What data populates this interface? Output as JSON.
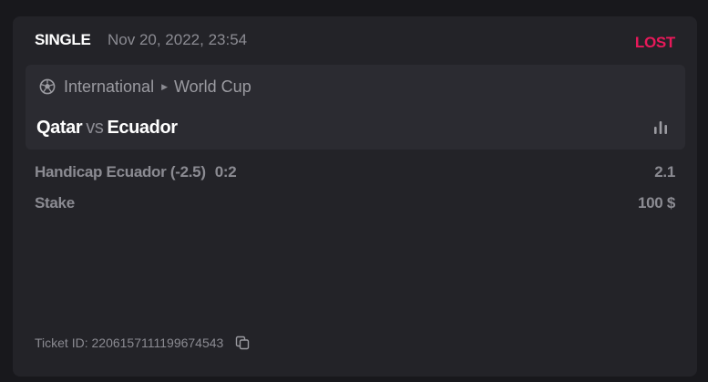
{
  "bet": {
    "type": "SINGLE",
    "date": "Nov 20, 2022, 23:54",
    "status": "LOST"
  },
  "event": {
    "sport_icon": "soccer-ball-icon",
    "category": "International",
    "separator_icon": "chevron-right-icon",
    "league": "World Cup",
    "home_team": "Qatar",
    "vs_label": "vs",
    "away_team": "Ecuador",
    "stats_icon": "bar-chart-icon"
  },
  "selection": {
    "market": "Handicap Ecuador (-2.5)",
    "score": "0:2",
    "odds": "2.1"
  },
  "stake": {
    "label": "Stake",
    "value": "100 $"
  },
  "ticket": {
    "label": "Ticket ID:",
    "id": "2206157111199674543",
    "copy_icon": "copy-icon"
  },
  "colors": {
    "background": "#18181c",
    "card": "#232328",
    "event_box": "#2b2b31",
    "lost": "#e8195a",
    "muted_text": "#8b8b92",
    "primary_text": "#ffffff"
  }
}
